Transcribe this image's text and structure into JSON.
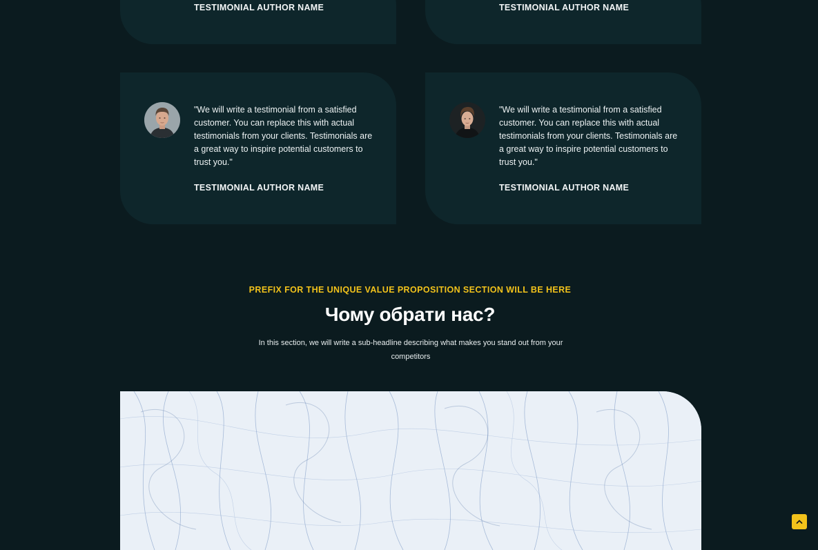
{
  "testimonials": [
    {
      "author": "TESTIMONIAL AUTHOR NAME"
    },
    {
      "author": "TESTIMONIAL AUTHOR NAME"
    },
    {
      "quote": "\"We will write a testimonial from a satisfied customer. You can replace this with actual testimonials from your clients. Testimonials are a great way to inspire potential customers to trust you.\"",
      "author": "TESTIMONIAL AUTHOR NAME",
      "avatar_icon": "man-portrait-avatar"
    },
    {
      "quote": "\"We will write a testimonial from a satisfied customer. You can replace this with actual testimonials from your clients. Testimonials are a great way to inspire potential customers to trust you.\"",
      "author": "TESTIMONIAL AUTHOR NAME",
      "avatar_icon": "man-portrait-avatar"
    }
  ],
  "value_proposition": {
    "prefix": "PREFIX FOR THE UNIQUE VALUE PROPOSITION SECTION WILL BE HERE",
    "headline": "Чому обрати нас?",
    "subheadline": "In this section, we will write a sub-headline describing what makes you stand out from your competitors"
  },
  "scroll_to_top": {
    "icon": "chevron-up-icon"
  },
  "colors": {
    "background": "#0b1b1f",
    "card": "#0e262b",
    "accent": "#f2c21b",
    "text": "#ffffff"
  }
}
